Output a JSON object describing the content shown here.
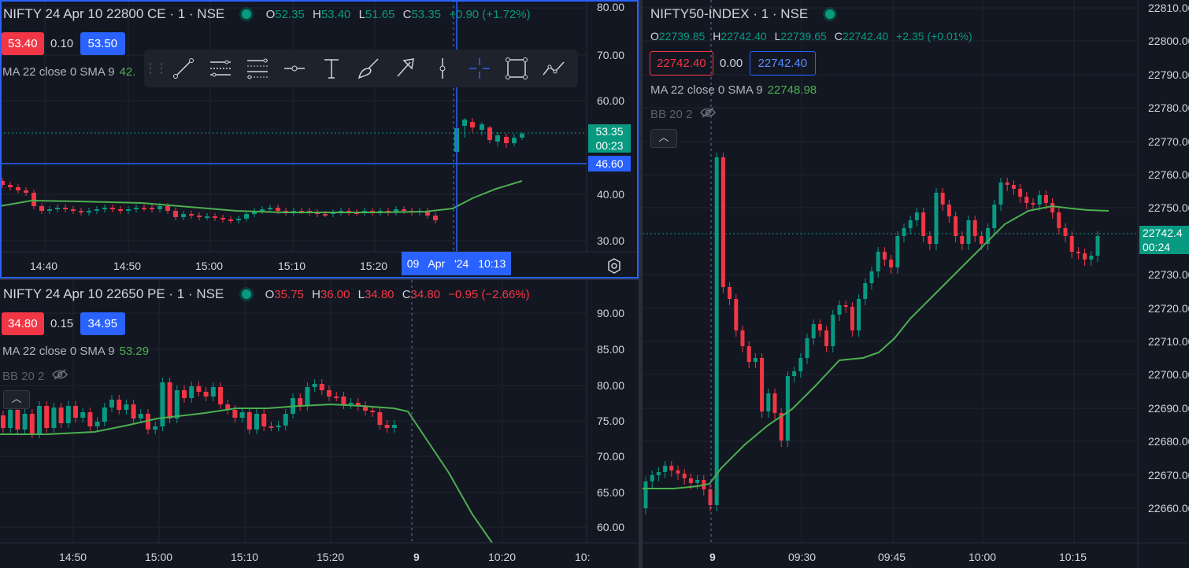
{
  "panes": {
    "ce": {
      "symbol": "NIFTY 24 Apr 10 22800 CE · 1 · NSE",
      "ohlc": {
        "o": "52.35",
        "h": "53.40",
        "l": "51.65",
        "c": "53.35",
        "chg": "+0.90 (+1.72%)"
      },
      "bid": "53.40",
      "spread": "0.10",
      "ask": "53.50",
      "ma_label": "MA 22 close 0 SMA 9",
      "ma_value": "42.",
      "last_price": "53.35",
      "countdown": "00:23",
      "crosshair_price": "46.60",
      "crosshair_date": "09 Apr '24  10:13",
      "y_ticks": [
        "80.00",
        "70.00",
        "60.00",
        "40.00",
        "30.00"
      ],
      "x_ticks": [
        "14:40",
        "14:50",
        "15:00",
        "15:10",
        "15:20"
      ]
    },
    "pe": {
      "symbol": "NIFTY 24 Apr 10 22650 PE · 1 · NSE",
      "ohlc": {
        "o": "35.75",
        "h": "36.00",
        "l": "34.80",
        "c": "34.80",
        "chg": "−0.95 (−2.66%)"
      },
      "bid": "34.80",
      "spread": "0.15",
      "ask": "34.95",
      "ma_label": "MA 22 close 0 SMA 9",
      "ma_value": "53.29",
      "bb_label": "BB 20 2",
      "y_ticks": [
        "90.00",
        "85.00",
        "80.00",
        "75.00",
        "70.00",
        "65.00",
        "60.00"
      ],
      "x_ticks": [
        "14:50",
        "15:00",
        "15:10",
        "15:20",
        "9",
        "10:20",
        "10:"
      ]
    },
    "idx": {
      "symbol": "NIFTY50-INDEX · 1 · NSE",
      "ohlc": {
        "o": "22739.85",
        "h": "22742.40",
        "l": "22739.65",
        "c": "22742.40",
        "chg": "+2.35 (+0.01%)"
      },
      "bid": "22742.40",
      "spread": "0.00",
      "ask": "22742.40",
      "ma_label": "MA 22 close 0 SMA 9",
      "ma_value": "22748.98",
      "bb_label": "BB 20 2",
      "last_price": "22742.4",
      "countdown": "00:24",
      "y_ticks": [
        "22810.00",
        "22800.00",
        "22790.00",
        "22780.00",
        "22770.00",
        "22760.00",
        "22750.00",
        "22730.00",
        "22720.00",
        "22710.00",
        "22700.00",
        "22690.00",
        "22680.00",
        "22670.00",
        "22660.00"
      ],
      "x_ticks": [
        "9",
        "09:30",
        "09:45",
        "10:00",
        "10:15"
      ]
    }
  },
  "toolbar": {
    "tools": [
      "trend-line",
      "parallel-channel",
      "fib-retracement",
      "horizontal-ray",
      "text",
      "brush",
      "arrow",
      "vertical-line",
      "cross-line",
      "rectangle",
      "path"
    ]
  },
  "colors": {
    "up": "#089981",
    "down": "#f23645",
    "ma": "#4caf50",
    "accent": "#2962ff",
    "bg": "#131722"
  },
  "chart_data": [
    {
      "type": "line",
      "title": "NIFTY 24 Apr 10 22800 CE · 1 · NSE",
      "series": [
        {
          "name": "MA 22 close 0 SMA 9",
          "values": [
            37,
            38.5,
            38,
            37.5,
            37,
            37,
            36.5,
            36.5,
            36.5,
            36.5,
            42,
            44
          ]
        }
      ],
      "ylim": [
        27,
        83
      ]
    },
    {
      "type": "line",
      "title": "NIFTY 24 Apr 10 22650 PE · 1 · NSE",
      "series": [
        {
          "name": "MA 22 close 0 SMA 9",
          "values": [
            73,
            73,
            73.5,
            74.5,
            76,
            76.5,
            77,
            77.5,
            77,
            77,
            76.5,
            69,
            62,
            57
          ]
        }
      ],
      "ylim": [
        57,
        93
      ]
    },
    {
      "type": "line",
      "title": "NIFTY50-INDEX · 1 · NSE",
      "series": [
        {
          "name": "MA 22 close 0 SMA 9",
          "values": [
            22665,
            22665,
            22668,
            22685,
            22697,
            22705,
            22706,
            22718,
            22732,
            22742,
            22747,
            22748
          ]
        }
      ],
      "ylim": [
        22655,
        22815
      ]
    }
  ]
}
